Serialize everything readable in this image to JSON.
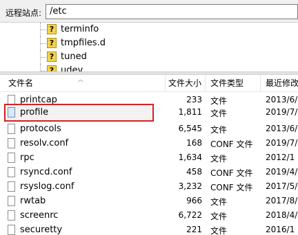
{
  "remote_site": {
    "label": "远程站点:",
    "path": "/etc"
  },
  "tree": {
    "items": [
      {
        "label": "terminfo",
        "icon": "question-folder-icon"
      },
      {
        "label": "tmpfiles.d",
        "icon": "question-folder-icon"
      },
      {
        "label": "tuned",
        "icon": "question-folder-icon"
      },
      {
        "label": "udev",
        "icon": "question-folder-icon"
      }
    ]
  },
  "file_list": {
    "columns": {
      "name": "文件名",
      "size": "文件大小",
      "type": "文件类型",
      "modified": "最近修改"
    },
    "rows": [
      {
        "name": "printcap",
        "size": "233",
        "type": "文件",
        "modified": "2013/6/"
      },
      {
        "name": "profile",
        "size": "1,811",
        "type": "文件",
        "modified": "2019/7/",
        "highlighted": true
      },
      {
        "name": "protocols",
        "size": "6,545",
        "type": "文件",
        "modified": "2013/6/"
      },
      {
        "name": "resolv.conf",
        "size": "168",
        "type": "CONF 文件",
        "modified": "2019/7/"
      },
      {
        "name": "rpc",
        "size": "1,634",
        "type": "文件",
        "modified": "2012/1"
      },
      {
        "name": "rsyncd.conf",
        "size": "458",
        "type": "CONF 文件",
        "modified": "2019/4/"
      },
      {
        "name": "rsyslog.conf",
        "size": "3,232",
        "type": "CONF 文件",
        "modified": "2017/5/"
      },
      {
        "name": "rwtab",
        "size": "966",
        "type": "文件",
        "modified": "2017/8/"
      },
      {
        "name": "screenrc",
        "size": "6,722",
        "type": "文件",
        "modified": "2018/4/"
      },
      {
        "name": "securetty",
        "size": "221",
        "type": "文件",
        "modified": "2016/1"
      }
    ]
  },
  "colors": {
    "highlight_border": "#d42020",
    "folder_icon": "#f5d247"
  }
}
